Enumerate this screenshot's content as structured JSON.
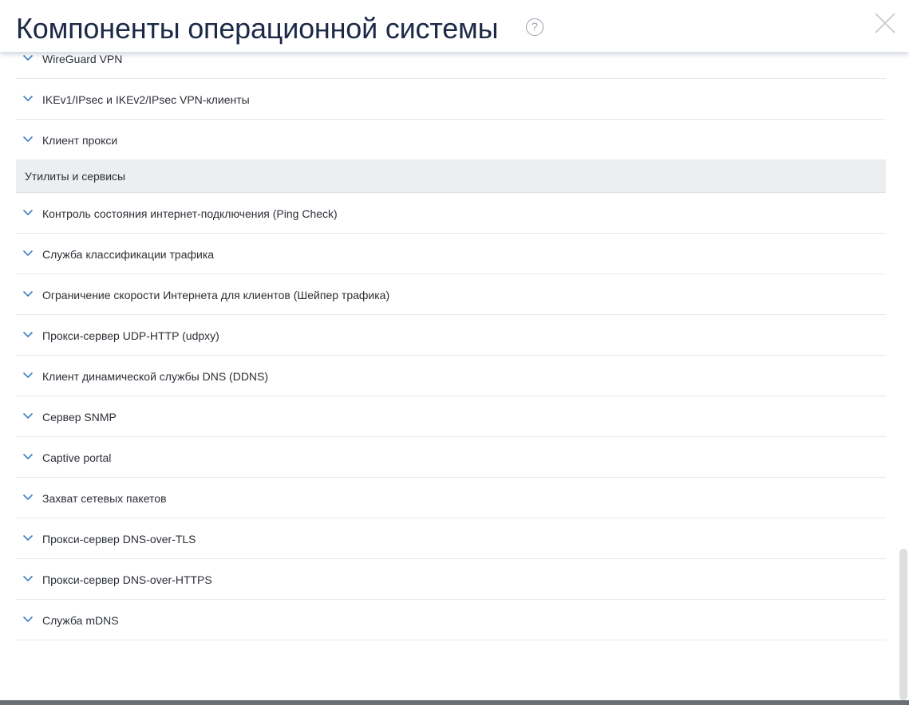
{
  "dialog": {
    "title": "Компоненты операционной системы",
    "help_symbol": "?",
    "icons": {
      "help": "question-circle-icon",
      "close": "close-x-icon",
      "expand": "chevron-down-icon"
    },
    "colors": {
      "title": "#1c2a48",
      "chevron": "#3d7fc4",
      "section_bg": "#eceef0",
      "divider": "#e6e8eb"
    }
  },
  "rows": [
    {
      "label": "WireGuard VPN"
    },
    {
      "label": "IKEv1/IPsec и IKEv2/IPsec VPN-клиенты"
    },
    {
      "label": "Клиент прокси"
    }
  ],
  "section": {
    "label": "Утилиты и сервисы"
  },
  "utilities": [
    {
      "label": "Контроль состояния интернет-подключения (Ping Check)"
    },
    {
      "label": "Служба классификации трафика"
    },
    {
      "label": "Ограничение скорости Интернета для клиентов (Шейпер трафика)"
    },
    {
      "label": "Прокси-сервер UDP-HTTP (udpxy)"
    },
    {
      "label": "Клиент динамической службы DNS (DDNS)"
    },
    {
      "label": "Сервер SNMP"
    },
    {
      "label": "Captive portal"
    },
    {
      "label": "Захват сетевых пакетов"
    },
    {
      "label": "Прокси-сервер DNS-over-TLS"
    },
    {
      "label": "Прокси-сервер DNS-over-HTTPS"
    },
    {
      "label": "Служба mDNS"
    }
  ]
}
